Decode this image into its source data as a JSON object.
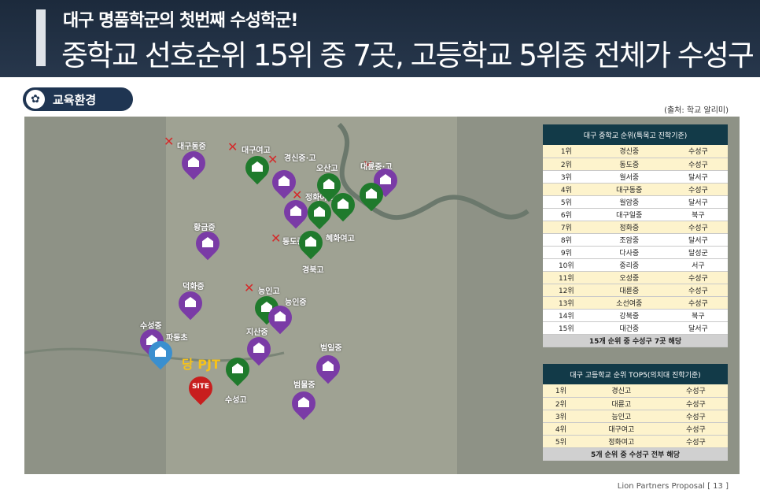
{
  "header": {
    "subtitle": "대구 명품학군의 첫번째 수성학군!",
    "title": "중학교 선호순위 15위 중 7곳, 고등학교 5위중 전체가 수성구"
  },
  "section": {
    "label": "교육환경",
    "source": "(출처: 학교 알리미)"
  },
  "map": {
    "labels": [
      "대구동중",
      "대구여고",
      "경신중·고",
      "오산고",
      "대륜중·고",
      "정화여고",
      "황금중",
      "동도중",
      "혜화여고",
      "경북고",
      "덕화중",
      "능인고",
      "능인중",
      "수성중",
      "파동초",
      "지산중",
      "범일중",
      "범물중",
      "수성고"
    ],
    "pjt_label": "당 PJT",
    "site_label": "SITE"
  },
  "middle_table": {
    "title": "대구 중학교 순위(특목고 진학기준)",
    "rows": [
      [
        "1위",
        "경신중",
        "수성구"
      ],
      [
        "2위",
        "동도중",
        "수성구"
      ],
      [
        "3위",
        "월서중",
        "달서구"
      ],
      [
        "4위",
        "대구동중",
        "수성구"
      ],
      [
        "5위",
        "월암중",
        "달서구"
      ],
      [
        "6위",
        "대구일중",
        "북구"
      ],
      [
        "7위",
        "정화중",
        "수성구"
      ],
      [
        "8위",
        "조암중",
        "달서구"
      ],
      [
        "9위",
        "다사중",
        "달성군"
      ],
      [
        "10위",
        "중리중",
        "서구"
      ],
      [
        "11위",
        "오성중",
        "수성구"
      ],
      [
        "12위",
        "대륜중",
        "수성구"
      ],
      [
        "13위",
        "소선여중",
        "수성구"
      ],
      [
        "14위",
        "강북중",
        "북구"
      ],
      [
        "15위",
        "대건중",
        "달서구"
      ]
    ],
    "footer": "15개 순위 중 수성구 7곳 해당"
  },
  "high_table": {
    "title": "대구 고등학교 순위 TOP5(의치대 진학기준)",
    "rows": [
      [
        "1위",
        "경신고",
        "수성구"
      ],
      [
        "2위",
        "대륜고",
        "수성구"
      ],
      [
        "3위",
        "능인고",
        "수성구"
      ],
      [
        "4위",
        "대구여고",
        "수성구"
      ],
      [
        "5위",
        "정화여고",
        "수성구"
      ]
    ],
    "footer": "5개 순위 중 수성구 전부 해당"
  },
  "page_footer": "Lion Partners Proposal [ 13 ]"
}
